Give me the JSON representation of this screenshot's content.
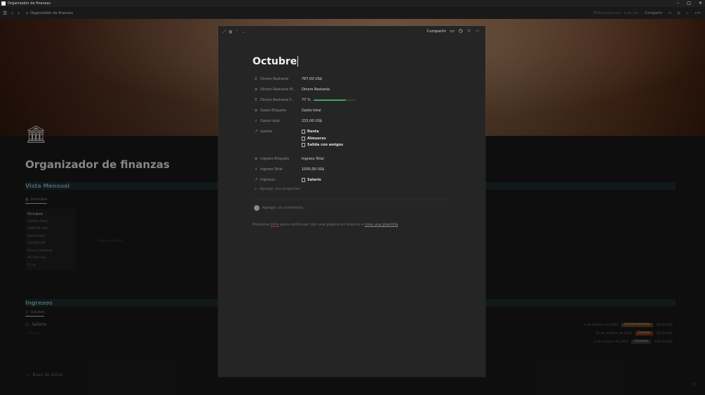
{
  "window": {
    "title": "Organizador de finanzas",
    "controls": [
      "–",
      "□",
      "✕"
    ]
  },
  "topbar": {
    "breadcrumb": "Organizador de finanzas",
    "edited": "Edited just now · 2 de oct.",
    "share": "Compartir"
  },
  "background_page": {
    "title": "Organizador de finanzas",
    "section_monthly": "Vista Mensual",
    "tab_overview": "Overview",
    "card": {
      "title": "Octubre",
      "lines": [
        "Ingreso Total",
        "1000,00 US$",
        "Gasto total",
        "233,00 US$",
        "Dinero Restante",
        "767,00 US$",
        "77 %"
      ]
    },
    "new_label": "+ Nueva página",
    "section_income": "Ingresos",
    "tab_october": "Octubre",
    "income_item": "Salario",
    "income_new": "+ Nueva",
    "right_rows": [
      {
        "date": "1 de octubre de 2023",
        "tag": "Entretenimiento",
        "tag_color": "#7a4a24",
        "amount": "50,00 US$"
      },
      {
        "date": "15 de octubre de 2023",
        "tag": "Comida",
        "tag_color": "#8a4a20",
        "amount": "33,00 US$"
      },
      {
        "date": "1 de octubre de 2023",
        "tag": "Vivienda",
        "tag_color": "#4a4a4a",
        "amount": "150,00 US$"
      }
    ],
    "db_link": "Base de datos"
  },
  "modal": {
    "topbar_share": "Compartir",
    "title": "Octubre",
    "properties": [
      {
        "icon": "Σ",
        "name": "Dinero Restante",
        "value": "767,00 US$"
      },
      {
        "icon": "≡",
        "name": "Dinero Restante Et...",
        "value": "Dinero Restante"
      },
      {
        "icon": "Σ",
        "name": "Dinero Restante F...",
        "value": "77 %",
        "progress": 0.77
      },
      {
        "icon": "≡",
        "name": "Gasto Etiqueta",
        "value": "Gasto total"
      },
      {
        "icon": "⌕",
        "name": "Gasto total",
        "value": "233,00 US$"
      },
      {
        "icon": "↗",
        "name": "Gastos",
        "relations": [
          "Renta",
          "Almuerzo",
          "Salida con amigos"
        ]
      },
      {
        "icon": "≡",
        "name": "Ingreso Etiqueta",
        "value": "Ingreso Total"
      },
      {
        "icon": "⌕",
        "name": "Ingreso Total",
        "value": "1000,00 US$"
      },
      {
        "icon": "↗",
        "name": "Ingresos",
        "relations": [
          "Salario"
        ]
      }
    ],
    "add_property": "Agregar una propiedad",
    "comment_placeholder": "Agregar un comentario...",
    "hint_prefix": "Presiona ",
    "hint_key": "Intro",
    "hint_middle": " para continuar con una página en blanco o ",
    "hint_link": "crea una plantilla"
  }
}
